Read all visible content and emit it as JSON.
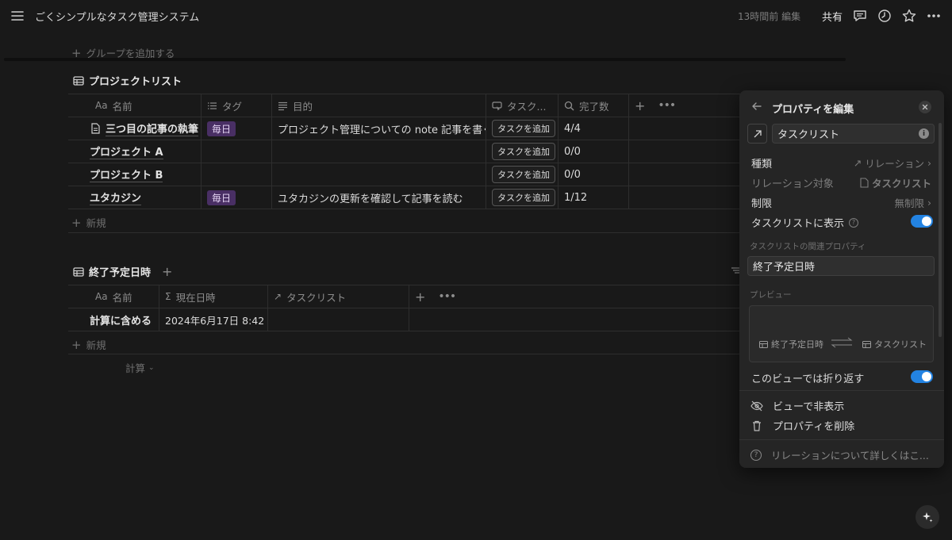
{
  "topbar": {
    "title": "ごくシンプルなタスク管理システム",
    "edited": "13時間前 編集",
    "share": "共有",
    "icons": [
      "menu-icon",
      "comment-icon",
      "clock-icon",
      "star-icon",
      "more-icon"
    ]
  },
  "add_group": "グループを追加する",
  "db1": {
    "title": "プロジェクトリスト",
    "columns": [
      {
        "icon": "Aa",
        "label": "名前"
      },
      {
        "icon": "list-icon",
        "label": "タグ"
      },
      {
        "icon": "text-icon",
        "label": "目的"
      },
      {
        "icon": "button-icon",
        "label": "タスク..."
      },
      {
        "icon": "search-icon",
        "label": "完了数"
      }
    ],
    "rows": [
      {
        "name": "三つ目の記事の執筆",
        "tag": "毎日",
        "purpose": "プロジェクト管理についての note 記事を書く",
        "button": "タスクを追加",
        "count": "4/4"
      },
      {
        "name": "プロジェクト A",
        "tag": "",
        "purpose": "",
        "button": "タスクを追加",
        "count": "0/0"
      },
      {
        "name": "プロジェクト B",
        "tag": "",
        "purpose": "",
        "button": "タスクを追加",
        "count": "0/0"
      },
      {
        "name": "ユタカジン",
        "tag": "毎日",
        "purpose": "ユタカジンの更新を確認して記事を読む",
        "button": "タスクを追加",
        "count": "1/12"
      }
    ],
    "new_label": "新規"
  },
  "db2": {
    "title": "終了予定日時",
    "columns": [
      {
        "icon": "Aa",
        "label": "名前"
      },
      {
        "icon": "Σ",
        "label": "現在日時"
      },
      {
        "icon": "↗",
        "label": "タスクリスト"
      }
    ],
    "rows": [
      {
        "name": "計算に含める",
        "datetime": "2024年6月17日 8:42",
        "tasklist": ""
      }
    ],
    "new_label": "新規",
    "calc_label": "計算"
  },
  "panel": {
    "title": "プロパティを編集",
    "name_value": "タスクリスト",
    "type_label": "種類",
    "type_value": "リレーション",
    "relation_target_label": "リレーション対象",
    "relation_target_value": "タスクリスト",
    "limit_label": "制限",
    "limit_value": "無制限",
    "show_in_label": "タスクリストに表示",
    "related_prop_header": "タスクリストの関連プロパティ",
    "related_prop_value": "終了予定日時",
    "preview_label": "プレビュー",
    "preview_left": "終了予定日時",
    "preview_right": "タスクリスト",
    "wrap_label": "このビューでは折り返す",
    "hide_label": "ビューで非表示",
    "delete_label": "プロパティを削除",
    "help_label": "リレーションについて詳しくはこ...",
    "show_in_enabled": true,
    "wrap_enabled": true
  },
  "colors": {
    "background": "#191919",
    "panel": "#252525",
    "toggle_on": "#2383e2",
    "tag_bg": "#492f64"
  }
}
